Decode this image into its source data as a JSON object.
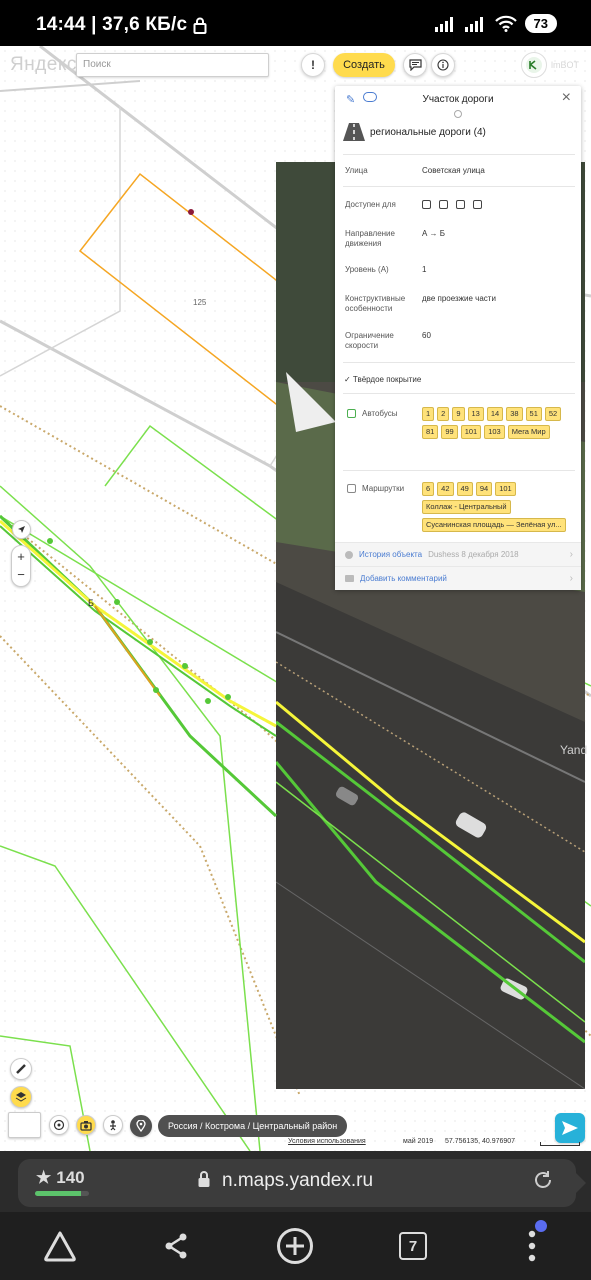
{
  "status_bar": {
    "time_speed": "14:44 | 37,6 КБ/с",
    "battery": "73"
  },
  "map": {
    "logo": "Яндекс",
    "search_placeholder": "Поиск",
    "alert_label": "!",
    "create_label": "Создать",
    "user_name": "lmBOT",
    "user_avatar_text": "lmBOT",
    "label_125": "125",
    "label_b": "Б",
    "watermark": "Yand",
    "breadcrumb": "Россия / Кострома / Центральный район",
    "terms": "Условия использования",
    "date": "май 2019",
    "coords": "57.756135, 40.976907",
    "zoom_in": "+",
    "zoom_out": "−"
  },
  "panel": {
    "title": "Участок дороги",
    "road_type": "региональные дороги (4)",
    "rows": {
      "street_label": "Улица",
      "street_value": "Советская улица",
      "access_label": "Доступен для",
      "direction_label": "Направление движения",
      "direction_value": "А → Б",
      "level_label": "Уровень (А)",
      "level_value": "1",
      "structure_label": "Конструктивные особенности",
      "structure_value": "две проезжие части",
      "speed_label": "Ограничение скорости",
      "speed_value": "60"
    },
    "hard_surface": "✓ Твёрдое покрытие",
    "buses_label": "Автобусы",
    "buses": [
      "1",
      "2",
      "9",
      "13",
      "14",
      "38",
      "51",
      "52",
      "81",
      "99",
      "101",
      "103",
      "Мега Мир"
    ],
    "minibus_label": "Маршрутки",
    "minibuses": [
      "6",
      "42",
      "49",
      "94",
      "101",
      "Коллаж - Центральный",
      "Сусанинская площадь — Зелёная ул..."
    ],
    "history_label": "История объекта",
    "history_meta": "Dushess 8 декабря 2018",
    "comment_label": "Добавить комментарий"
  },
  "browser": {
    "rating": "140",
    "rating_fraction": 0.85,
    "url": "n.maps.yandex.ru",
    "tabs_count": "7"
  },
  "colors": {
    "accent_yellow": "#ffdb4d",
    "link_blue": "#4a7cd1",
    "road_green": "#4caf50"
  }
}
